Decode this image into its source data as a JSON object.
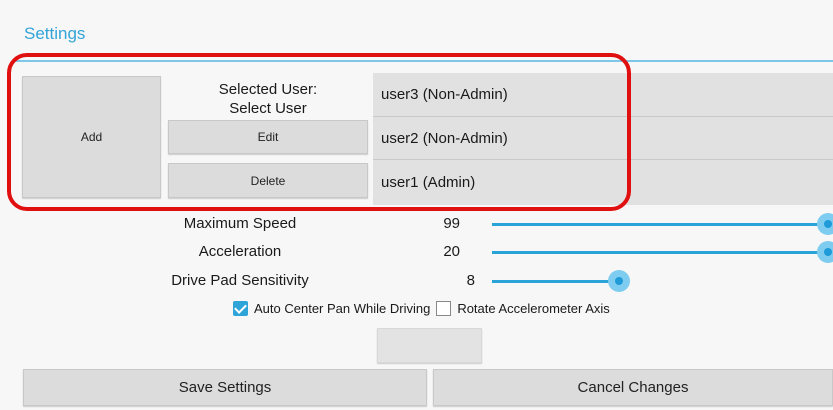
{
  "settings": {
    "title": "Settings"
  },
  "users": {
    "add_label": "Add",
    "selected_label": "Selected User:",
    "selected_value": "Select User",
    "edit_label": "Edit",
    "delete_label": "Delete",
    "list": [
      "user3 (Non-Admin)",
      "user2 (Non-Admin)",
      "user1 (Admin)"
    ]
  },
  "sliders": [
    {
      "label": "Maximum Speed",
      "value": "99",
      "fraction": 1.0
    },
    {
      "label": "Acceleration",
      "value": "20",
      "fraction": 1.0
    },
    {
      "label": "Drive Pad Sensitivity",
      "value": "8",
      "fraction": 0.38
    }
  ],
  "options": {
    "auto_center_label": "Auto Center Pan While Driving",
    "auto_center_checked": true,
    "rotate_label": "Rotate Accelerometer Axis",
    "rotate_checked": false
  },
  "footer": {
    "save_label": "Save Settings",
    "cancel_label": "Cancel Changes"
  },
  "colors": {
    "accent": "#2aa3d9",
    "highlight": "#e01010"
  }
}
